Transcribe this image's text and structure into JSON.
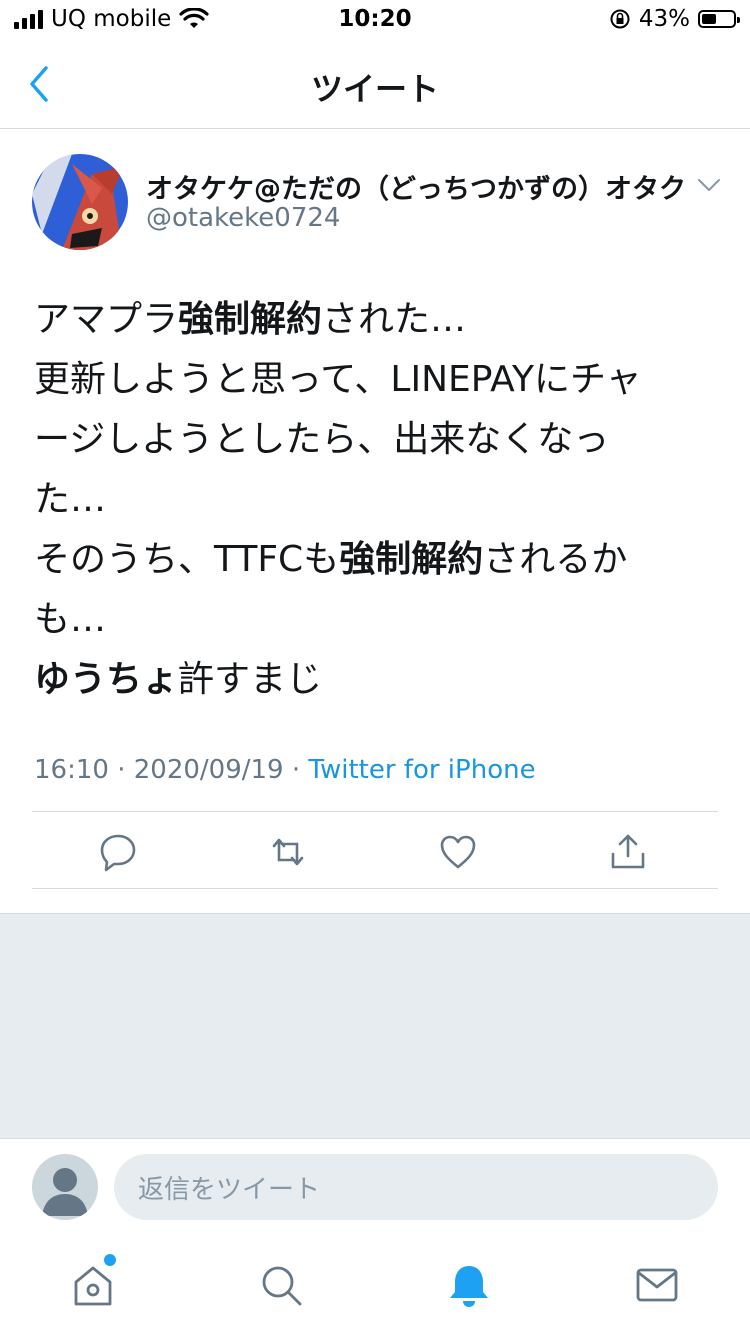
{
  "status_bar": {
    "carrier": "UQ mobile",
    "time": "10:20",
    "battery_percent": "43%"
  },
  "nav": {
    "title": "ツイート",
    "back_icon": "chevron-left-icon"
  },
  "tweet": {
    "display_name": "オタケケ@ただの（どっちつかずの）オタク",
    "handle": "@otakeke0724",
    "lines": [
      [
        {
          "t": "アマプラ",
          "b": false
        },
        {
          "t": "強制解約",
          "b": true
        },
        {
          "t": "された…",
          "b": false
        }
      ],
      [
        {
          "t": "更新しようと思って、LINEPAYにチャ",
          "b": false
        }
      ],
      [
        {
          "t": "ージしようとしたら、出来なくなっ",
          "b": false
        }
      ],
      [
        {
          "t": "た…",
          "b": false
        }
      ],
      [
        {
          "t": "そのうち、TTFCも",
          "b": false
        },
        {
          "t": "強制解約",
          "b": true
        },
        {
          "t": "されるか",
          "b": false
        }
      ],
      [
        {
          "t": "も…",
          "b": false
        }
      ],
      [
        {
          "t": "ゆうちょ",
          "b": true
        },
        {
          "t": "許すまじ",
          "b": false
        }
      ]
    ],
    "time": "16:10",
    "date": "2020/09/19",
    "separator": "·",
    "source_app": "Twitter for iPhone"
  },
  "actions": {
    "icons": [
      "reply-icon",
      "retweet-icon",
      "like-icon",
      "share-icon"
    ]
  },
  "reply": {
    "placeholder": "返信をツイート"
  },
  "tabbar": {
    "icons": [
      "home-icon",
      "search-icon",
      "notifications-icon",
      "messages-icon"
    ],
    "active": "notifications-icon"
  },
  "colors": {
    "accent": "#1da1f2",
    "link": "#1b95e0",
    "secondary_text": "#657786",
    "divider": "#d6dbe0",
    "background_gray": "#e6ecf0"
  }
}
